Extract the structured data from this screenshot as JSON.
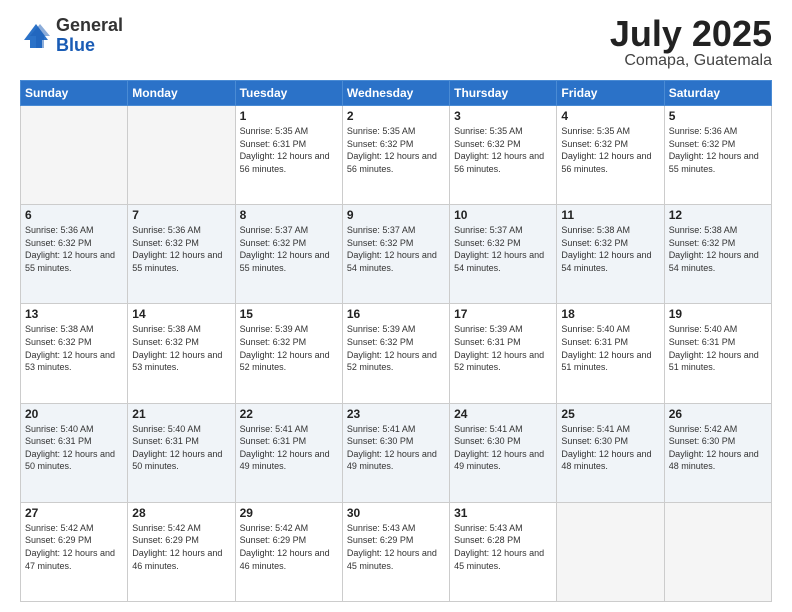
{
  "logo": {
    "general": "General",
    "blue": "Blue"
  },
  "title": {
    "month": "July 2025",
    "location": "Comapa, Guatemala"
  },
  "days_of_week": [
    "Sunday",
    "Monday",
    "Tuesday",
    "Wednesday",
    "Thursday",
    "Friday",
    "Saturday"
  ],
  "weeks": [
    [
      {
        "day": "",
        "info": ""
      },
      {
        "day": "",
        "info": ""
      },
      {
        "day": "1",
        "info": "Sunrise: 5:35 AM\nSunset: 6:31 PM\nDaylight: 12 hours and 56 minutes."
      },
      {
        "day": "2",
        "info": "Sunrise: 5:35 AM\nSunset: 6:32 PM\nDaylight: 12 hours and 56 minutes."
      },
      {
        "day": "3",
        "info": "Sunrise: 5:35 AM\nSunset: 6:32 PM\nDaylight: 12 hours and 56 minutes."
      },
      {
        "day": "4",
        "info": "Sunrise: 5:35 AM\nSunset: 6:32 PM\nDaylight: 12 hours and 56 minutes."
      },
      {
        "day": "5",
        "info": "Sunrise: 5:36 AM\nSunset: 6:32 PM\nDaylight: 12 hours and 55 minutes."
      }
    ],
    [
      {
        "day": "6",
        "info": "Sunrise: 5:36 AM\nSunset: 6:32 PM\nDaylight: 12 hours and 55 minutes."
      },
      {
        "day": "7",
        "info": "Sunrise: 5:36 AM\nSunset: 6:32 PM\nDaylight: 12 hours and 55 minutes."
      },
      {
        "day": "8",
        "info": "Sunrise: 5:37 AM\nSunset: 6:32 PM\nDaylight: 12 hours and 55 minutes."
      },
      {
        "day": "9",
        "info": "Sunrise: 5:37 AM\nSunset: 6:32 PM\nDaylight: 12 hours and 54 minutes."
      },
      {
        "day": "10",
        "info": "Sunrise: 5:37 AM\nSunset: 6:32 PM\nDaylight: 12 hours and 54 minutes."
      },
      {
        "day": "11",
        "info": "Sunrise: 5:38 AM\nSunset: 6:32 PM\nDaylight: 12 hours and 54 minutes."
      },
      {
        "day": "12",
        "info": "Sunrise: 5:38 AM\nSunset: 6:32 PM\nDaylight: 12 hours and 54 minutes."
      }
    ],
    [
      {
        "day": "13",
        "info": "Sunrise: 5:38 AM\nSunset: 6:32 PM\nDaylight: 12 hours and 53 minutes."
      },
      {
        "day": "14",
        "info": "Sunrise: 5:38 AM\nSunset: 6:32 PM\nDaylight: 12 hours and 53 minutes."
      },
      {
        "day": "15",
        "info": "Sunrise: 5:39 AM\nSunset: 6:32 PM\nDaylight: 12 hours and 52 minutes."
      },
      {
        "day": "16",
        "info": "Sunrise: 5:39 AM\nSunset: 6:32 PM\nDaylight: 12 hours and 52 minutes."
      },
      {
        "day": "17",
        "info": "Sunrise: 5:39 AM\nSunset: 6:31 PM\nDaylight: 12 hours and 52 minutes."
      },
      {
        "day": "18",
        "info": "Sunrise: 5:40 AM\nSunset: 6:31 PM\nDaylight: 12 hours and 51 minutes."
      },
      {
        "day": "19",
        "info": "Sunrise: 5:40 AM\nSunset: 6:31 PM\nDaylight: 12 hours and 51 minutes."
      }
    ],
    [
      {
        "day": "20",
        "info": "Sunrise: 5:40 AM\nSunset: 6:31 PM\nDaylight: 12 hours and 50 minutes."
      },
      {
        "day": "21",
        "info": "Sunrise: 5:40 AM\nSunset: 6:31 PM\nDaylight: 12 hours and 50 minutes."
      },
      {
        "day": "22",
        "info": "Sunrise: 5:41 AM\nSunset: 6:31 PM\nDaylight: 12 hours and 49 minutes."
      },
      {
        "day": "23",
        "info": "Sunrise: 5:41 AM\nSunset: 6:30 PM\nDaylight: 12 hours and 49 minutes."
      },
      {
        "day": "24",
        "info": "Sunrise: 5:41 AM\nSunset: 6:30 PM\nDaylight: 12 hours and 49 minutes."
      },
      {
        "day": "25",
        "info": "Sunrise: 5:41 AM\nSunset: 6:30 PM\nDaylight: 12 hours and 48 minutes."
      },
      {
        "day": "26",
        "info": "Sunrise: 5:42 AM\nSunset: 6:30 PM\nDaylight: 12 hours and 48 minutes."
      }
    ],
    [
      {
        "day": "27",
        "info": "Sunrise: 5:42 AM\nSunset: 6:29 PM\nDaylight: 12 hours and 47 minutes."
      },
      {
        "day": "28",
        "info": "Sunrise: 5:42 AM\nSunset: 6:29 PM\nDaylight: 12 hours and 46 minutes."
      },
      {
        "day": "29",
        "info": "Sunrise: 5:42 AM\nSunset: 6:29 PM\nDaylight: 12 hours and 46 minutes."
      },
      {
        "day": "30",
        "info": "Sunrise: 5:43 AM\nSunset: 6:29 PM\nDaylight: 12 hours and 45 minutes."
      },
      {
        "day": "31",
        "info": "Sunrise: 5:43 AM\nSunset: 6:28 PM\nDaylight: 12 hours and 45 minutes."
      },
      {
        "day": "",
        "info": ""
      },
      {
        "day": "",
        "info": ""
      }
    ]
  ]
}
